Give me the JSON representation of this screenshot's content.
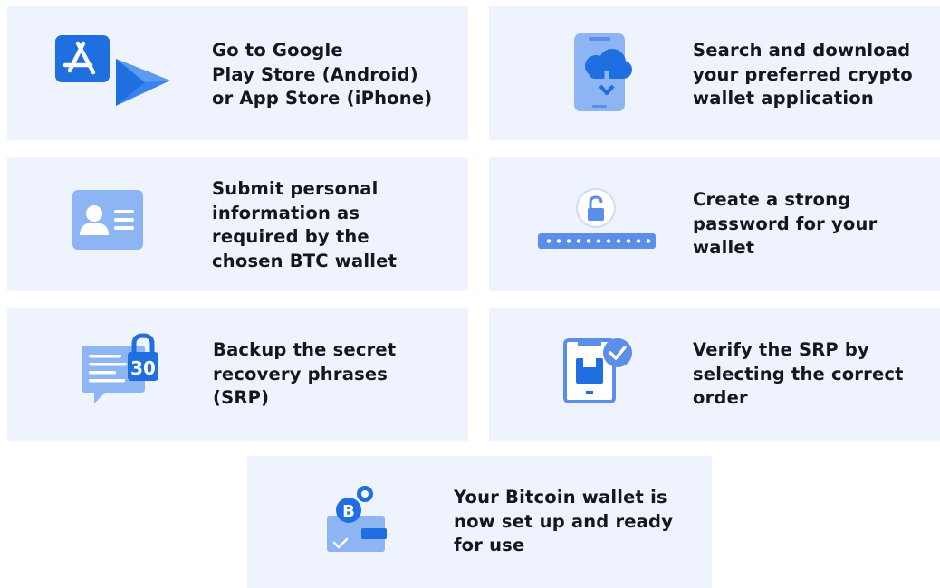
{
  "steps": [
    {
      "icon": "app-store-google-play-icon",
      "lines": [
        "Go to Google",
        "Play Store (Android)",
        "or App Store (iPhone)"
      ]
    },
    {
      "icon": "phone-download-icon",
      "lines": [
        "Search and download",
        "your preferred crypto",
        "wallet application"
      ]
    },
    {
      "icon": "id-card-icon",
      "lines": [
        "Submit personal",
        "information as",
        "required by the",
        "chosen BTC wallet"
      ]
    },
    {
      "icon": "password-lock-icon",
      "lines": [
        "Create a strong",
        "password for your",
        "wallet"
      ]
    },
    {
      "icon": "secret-phrase-chat-icon",
      "lines": [
        "Backup the secret",
        "recovery phrases",
        "(SRP)"
      ]
    },
    {
      "icon": "verify-check-icon",
      "lines": [
        "Verify the SRP by",
        "selecting the correct",
        "order"
      ]
    },
    {
      "icon": "bitcoin-wallet-icon",
      "lines": [
        "Your Bitcoin wallet is",
        "now set up and ready",
        "for use"
      ]
    }
  ],
  "icon_texts": {
    "seed_count": "30",
    "bitcoin_symbol": "B"
  },
  "colors": {
    "card_bg": "#eef3fd",
    "icon_primary": "#1f6fe0",
    "icon_light": "#8db4f3",
    "icon_mid": "#5b8ee8",
    "text": "#16161d"
  }
}
